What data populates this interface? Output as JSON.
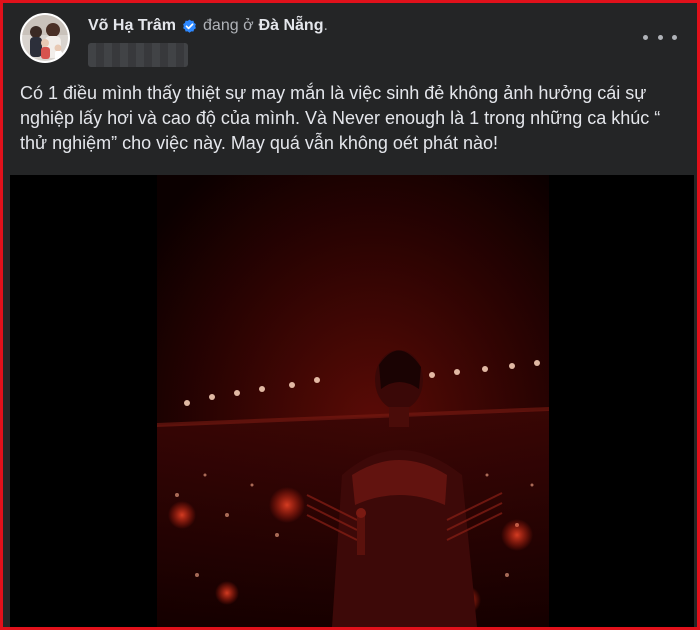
{
  "post": {
    "author_name": "Võ Hạ Trâm",
    "status_prefix": "đang ở",
    "location": "Đà Nẵng",
    "location_suffix": ".",
    "text": "Có 1 điều mình thấy thiệt sự may mắn là việc sinh đẻ không ảnh hưởng cái sự nghiệp lấy hơi và cao độ của mình. Và Never enough là 1 trong những ca khúc “ thử nghiệm” cho việc này. May quá vẫn không oét phát nào!"
  },
  "icons": {
    "verified": "verified-badge-icon",
    "more": "more-options-icon"
  },
  "colors": {
    "background": "#242526",
    "text": "#e4e6eb",
    "secondary_text": "#b0b3b8",
    "verified_blue": "#2d88ff",
    "frame_border": "#e0111b"
  }
}
